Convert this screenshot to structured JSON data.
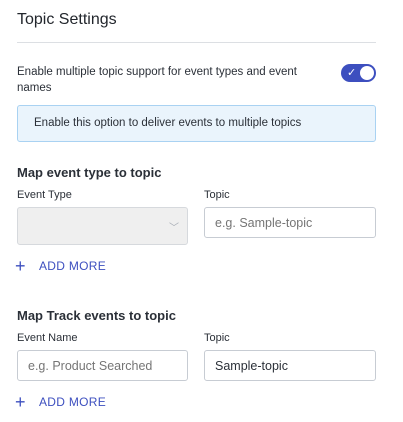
{
  "page": {
    "title": "Topic Settings"
  },
  "multi_topic": {
    "label": "Enable multiple topic support for event types and event names",
    "enabled": true,
    "toggle_check": "✓",
    "info": "Enable this option to deliver events to multiple topics"
  },
  "event_type_section": {
    "title": "Map event type to topic",
    "event_type_label": "Event Type",
    "event_type_value": "",
    "topic_label": "Topic",
    "topic_placeholder": "e.g. Sample-topic",
    "add_more": "ADD MORE"
  },
  "track_section": {
    "title": "Map Track events to topic",
    "event_name_label": "Event Name",
    "event_name_placeholder": "e.g. Product Searched",
    "topic_label": "Topic",
    "topic_value": "Sample-topic",
    "add_more": "ADD MORE"
  },
  "icons": {
    "plus": "+",
    "chevron": "﹀"
  },
  "colors": {
    "accent": "#3d4fbf",
    "info_bg": "#eaf4fc",
    "info_border": "#a9d2f2"
  }
}
